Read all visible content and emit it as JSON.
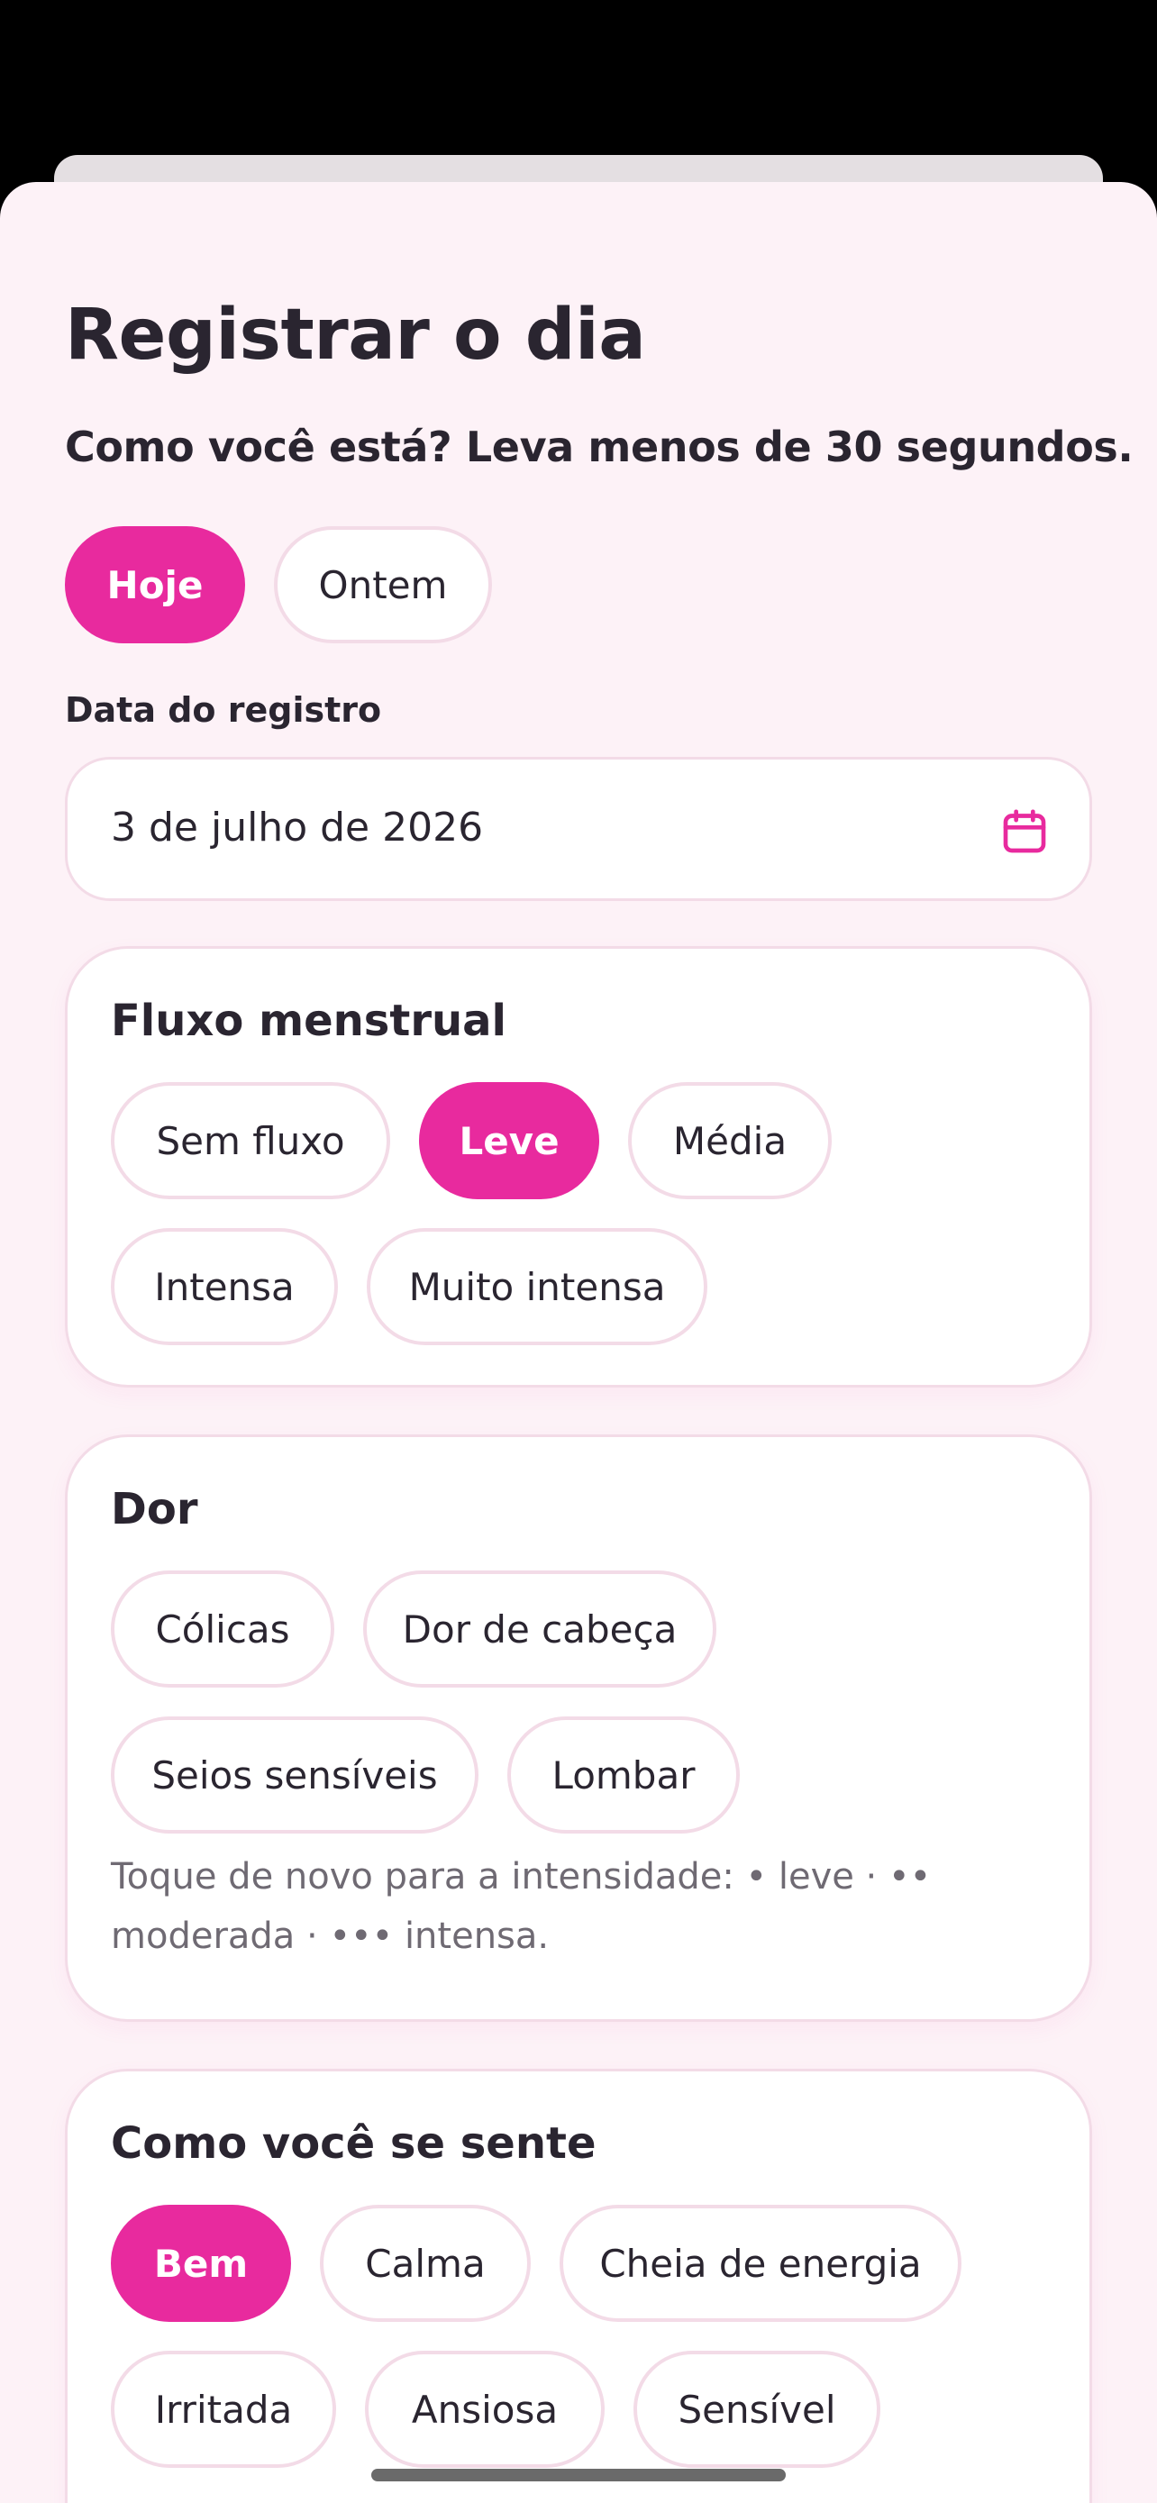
{
  "page": {
    "title": "Registrar o dia",
    "subtitle": "Como você está? Leva menos de 30 segundos."
  },
  "day_toggle": {
    "options": [
      "Hoje",
      "Ontem"
    ],
    "selected": "Hoje"
  },
  "date_field": {
    "label": "Data do registro",
    "value": "3 de julho de 2026",
    "icon": "calendar-icon"
  },
  "flow": {
    "title": "Fluxo menstrual",
    "options": [
      "Sem fluxo",
      "Leve",
      "Média",
      "Intensa",
      "Muito intensa"
    ],
    "selected": "Leve"
  },
  "pain": {
    "title": "Dor",
    "options": [
      "Cólicas",
      "Dor de cabeça",
      "Seios sensíveis",
      "Lombar"
    ],
    "hint": "Toque de novo para a intensidade: • leve · •• moderada · ••• intensa."
  },
  "mood": {
    "title": "Como você se sente",
    "options": [
      "Bem",
      "Calma",
      "Cheia de energia",
      "Irritada",
      "Ansiosa",
      "Sensível"
    ],
    "selected": "Bem"
  },
  "colors": {
    "accent": "#e82a9e",
    "background": "#fdf2f7",
    "border": "#f3dbe7",
    "text": "#2a2530",
    "muted": "#6f6a73"
  }
}
